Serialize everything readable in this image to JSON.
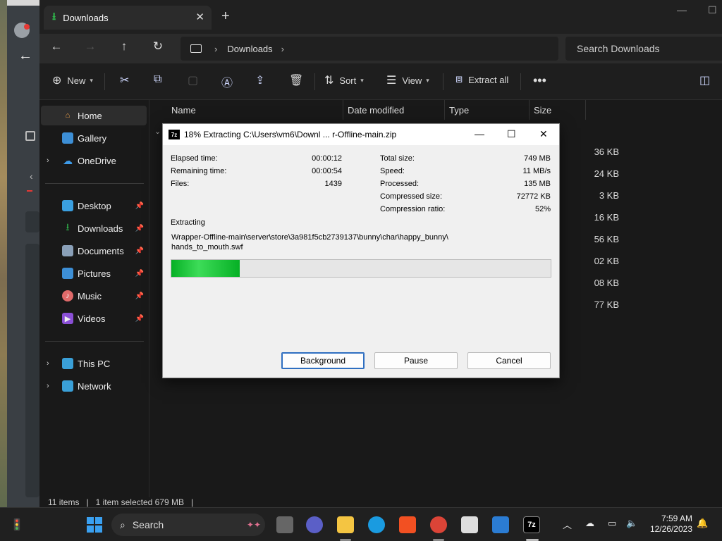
{
  "explorer": {
    "tab_title": "Downloads",
    "breadcrumb": "Downloads",
    "search_placeholder": "Search Downloads",
    "toolbar": {
      "new_label": "New",
      "sort_label": "Sort",
      "view_label": "View",
      "extract_all_label": "Extract all"
    },
    "sidebar": {
      "home": "Home",
      "gallery": "Gallery",
      "onedrive": "OneDrive",
      "desktop": "Desktop",
      "downloads": "Downloads",
      "documents": "Documents",
      "pictures": "Pictures",
      "music": "Music",
      "videos": "Videos",
      "this_pc": "This PC",
      "network": "Network"
    },
    "columns": {
      "name": "Name",
      "date_modified": "Date modified",
      "type": "Type",
      "size": "Size"
    },
    "size_values": [
      "36 KB",
      "24 KB",
      "3 KB",
      "16 KB",
      "56 KB",
      "02 KB",
      "08 KB",
      "77 KB"
    ],
    "status": {
      "items": "11 items",
      "selected": "1 item selected  679 MB"
    }
  },
  "dialog": {
    "title": "18% Extracting C:\\Users\\vm6\\Downl ... r-Offline-main.zip",
    "progress_percent": 18,
    "left_stats": [
      {
        "label": "Elapsed time:",
        "value": "00:00:12"
      },
      {
        "label": "Remaining time:",
        "value": "00:00:54"
      },
      {
        "label": "Files:",
        "value": "1439"
      }
    ],
    "right_stats": [
      {
        "label": "Total size:",
        "value": "749 MB"
      },
      {
        "label": "Speed:",
        "value": "11 MB/s"
      },
      {
        "label": "Processed:",
        "value": "135 MB"
      },
      {
        "label": "Compressed size:",
        "value": "72772 KB"
      },
      {
        "label": "Compression ratio:",
        "value": "52%"
      }
    ],
    "action_label": "Extracting",
    "current_path_line1": "Wrapper-Offline-main\\server\\store\\3a981f5cb2739137\\bunny\\char\\happy_bunny\\",
    "current_path_line2": "hands_to_mouth.swf",
    "buttons": {
      "background": "Background",
      "pause": "Pause",
      "cancel": "Cancel"
    }
  },
  "taskbar": {
    "search_label": "Search",
    "time": "7:59 AM",
    "date": "12/26/2023"
  },
  "colors": {
    "progress_green": "#06b025",
    "accent_blue": "#2f6fc1"
  }
}
